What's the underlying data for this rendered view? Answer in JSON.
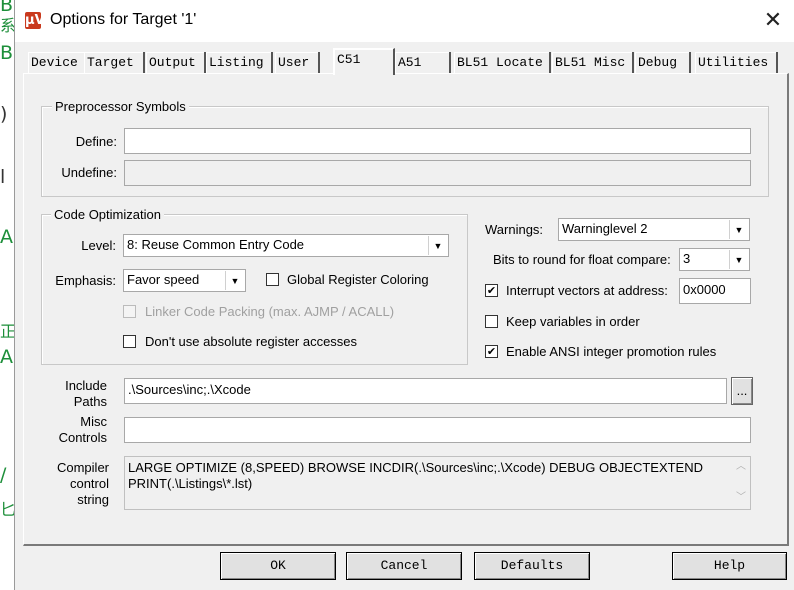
{
  "window": {
    "title": "Options for Target '1'",
    "close_glyph": "✕",
    "app_icon": "µV"
  },
  "background_app": {
    "edge_chars": [
      "B",
      "系",
      "B",
      ")",
      "l",
      "A",
      "正",
      "A",
      "/",
      "匕"
    ]
  },
  "tabs": [
    {
      "label": "Device"
    },
    {
      "label": "Target"
    },
    {
      "label": "Output"
    },
    {
      "label": "Listing"
    },
    {
      "label": "User"
    },
    {
      "label": "C51",
      "active": true
    },
    {
      "label": "A51"
    },
    {
      "label": "BL51 Locate"
    },
    {
      "label": "BL51 Misc"
    },
    {
      "label": "Debug"
    },
    {
      "label": "Utilities"
    }
  ],
  "preprocessor": {
    "group_label": "Preprocessor Symbols",
    "define_label": "Define:",
    "define_value": "",
    "undefine_label": "Undefine:",
    "undefine_value": ""
  },
  "code_opt": {
    "group_label": "Code Optimization",
    "level_label": "Level:",
    "level_value": "8: Reuse Common Entry Code",
    "emphasis_label": "Emphasis:",
    "emphasis_value": "Favor speed",
    "global_reg_label": "Global Register Coloring",
    "global_reg_checked": false,
    "linker_label": "Linker Code Packing (max. AJMP / ACALL)",
    "linker_checked": false,
    "abs_reg_label": "Don't use absolute register accesses",
    "abs_reg_checked": false
  },
  "right_opts": {
    "warnings_label": "Warnings:",
    "warnings_value": "Warninglevel 2",
    "bits_label": "Bits to round for float compare:",
    "bits_value": "3",
    "interrupt_label": "Interrupt vectors at address:",
    "interrupt_checked": true,
    "interrupt_value": "0x0000",
    "keepvars_label": "Keep variables in order",
    "keepvars_checked": false,
    "ansi_label": "Enable ANSI integer promotion rules",
    "ansi_checked": true
  },
  "paths": {
    "include_label_1": "Include",
    "include_label_2": "Paths",
    "include_value": ".\\Sources\\inc;.\\Xcode",
    "browse_label": "...",
    "misc_label_1": "Misc",
    "misc_label_2": "Controls",
    "misc_value": "",
    "compiler_label_1": "Compiler",
    "compiler_label_2": "control",
    "compiler_label_3": "string",
    "compiler_value": "LARGE OPTIMIZE (8,SPEED) BROWSE INCDIR(.\\Sources\\inc;.\\Xcode) DEBUG OBJECTEXTEND PRINT(.\\Listings\\*.lst)"
  },
  "buttons": {
    "ok": "OK",
    "cancel": "Cancel",
    "defaults": "Defaults",
    "help": "Help"
  },
  "glyphs": {
    "check": "✔",
    "dropdown": "▼",
    "scroll_up": "︿",
    "scroll_down": "﹀"
  }
}
